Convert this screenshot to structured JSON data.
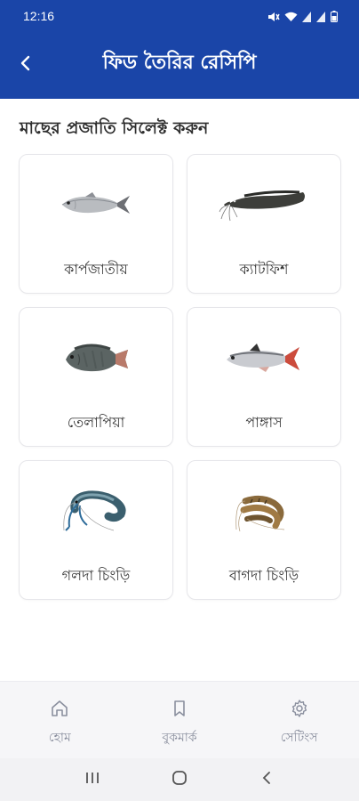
{
  "status_bar": {
    "time": "12:16",
    "icons": [
      "mute-icon",
      "wifi-icon",
      "signal-icon",
      "signal-icon",
      "battery-icon"
    ]
  },
  "header": {
    "back_icon": "chevron-left-icon",
    "title": "ফিড তৈরির রেসিপি",
    "background_color": "#1a45a8"
  },
  "content": {
    "heading": "মাছের প্রজাতি সিলেক্ট করুন",
    "species": [
      {
        "label": "কার্পজাতীয়",
        "image": "carp-fish-image"
      },
      {
        "label": "ক্যাটফিশ",
        "image": "catfish-image"
      },
      {
        "label": "তেলাপিয়া",
        "image": "tilapia-fish-image"
      },
      {
        "label": "পাঙ্গাস",
        "image": "pangas-fish-image"
      },
      {
        "label": "গলদা চিংড়ি",
        "image": "golda-prawn-image"
      },
      {
        "label": "বাগদা চিংড়ি",
        "image": "bagda-shrimp-image"
      }
    ]
  },
  "bottom_nav": {
    "items": [
      {
        "label": "হোম",
        "icon": "home-icon"
      },
      {
        "label": "বুকমার্ক",
        "icon": "bookmark-icon"
      },
      {
        "label": "সেটিংস",
        "icon": "gear-icon"
      }
    ]
  },
  "system_nav": {
    "buttons": [
      "recents-icon",
      "home-circle-icon",
      "back-icon"
    ]
  }
}
